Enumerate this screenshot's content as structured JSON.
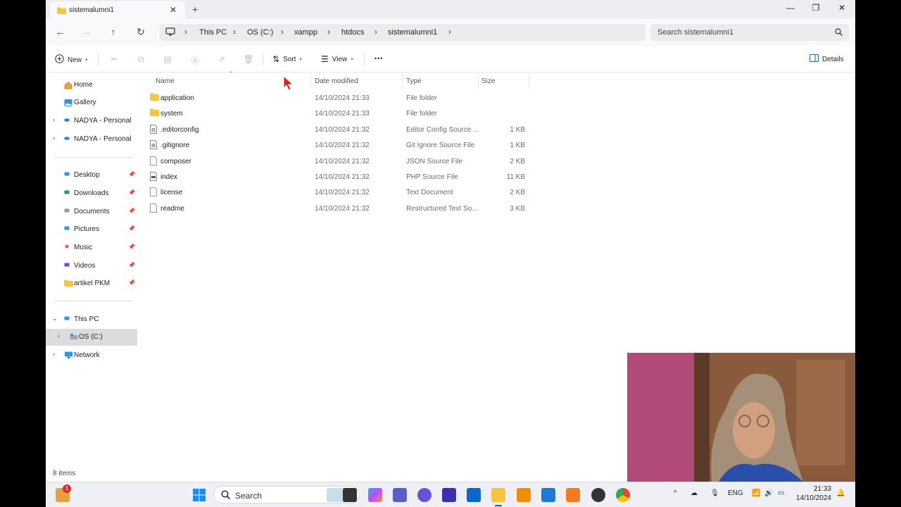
{
  "window": {
    "tab_title": "sistemalumni1",
    "new_tab": "+",
    "close_tab": "✕",
    "minimize": "—",
    "maximize": "❐",
    "close": "✕"
  },
  "address": {
    "crumbs": [
      "This PC",
      "OS (C:)",
      "xampp",
      "htdocs",
      "sistemalumni1"
    ],
    "search_placeholder": "Search sistemalumni1"
  },
  "commands": {
    "new": "New",
    "sort": "Sort",
    "view": "View",
    "more": "•••",
    "details": "Details"
  },
  "sidebar": {
    "quick": [
      {
        "label": "Home",
        "icon": "home-icon"
      },
      {
        "label": "Gallery",
        "icon": "gallery-icon"
      },
      {
        "label": "NADYA - Personal",
        "icon": "onedrive-icon"
      },
      {
        "label": "NADYA - Personal",
        "icon": "onedrive-icon"
      }
    ],
    "pinned": [
      {
        "label": "Desktop",
        "icon": "desktop-icon"
      },
      {
        "label": "Downloads",
        "icon": "downloads-icon"
      },
      {
        "label": "Documents",
        "icon": "documents-icon"
      },
      {
        "label": "Pictures",
        "icon": "pictures-icon"
      },
      {
        "label": "Music",
        "icon": "music-icon"
      },
      {
        "label": "Videos",
        "icon": "videos-icon"
      },
      {
        "label": "artikel PKM",
        "icon": "folder-icon"
      }
    ],
    "tree": [
      {
        "label": "This PC",
        "icon": "pc-icon"
      },
      {
        "label": "OS (C:)",
        "icon": "drive-icon"
      },
      {
        "label": "Network",
        "icon": "network-icon"
      }
    ]
  },
  "columns": {
    "name": "Name",
    "date": "Date modified",
    "type": "Type",
    "size": "Size"
  },
  "files": [
    {
      "name": "application",
      "date": "14/10/2024 21:33",
      "type": "File folder",
      "size": "",
      "icon": "folder-icon"
    },
    {
      "name": "system",
      "date": "14/10/2024 21:33",
      "type": "File folder",
      "size": "",
      "icon": "folder-icon"
    },
    {
      "name": ".editorconfig",
      "date": "14/10/2024 21:32",
      "type": "Editor Config Source ...",
      "size": "1 KB",
      "icon": "config-file-icon"
    },
    {
      "name": ".gitignore",
      "date": "14/10/2024 21:32",
      "type": "Git Ignore Source File",
      "size": "1 KB",
      "icon": "config-file-icon"
    },
    {
      "name": "composer",
      "date": "14/10/2024 21:32",
      "type": "JSON Source File",
      "size": "2 KB",
      "icon": "file-icon"
    },
    {
      "name": "index",
      "date": "14/10/2024 21:32",
      "type": "PHP Source File",
      "size": "11 KB",
      "icon": "php-file-icon"
    },
    {
      "name": "license",
      "date": "14/10/2024 21:32",
      "type": "Text Document",
      "size": "2 KB",
      "icon": "file-icon"
    },
    {
      "name": "readme",
      "date": "14/10/2024 21:32",
      "type": "Restructured Text So...",
      "size": "3 KB",
      "icon": "file-icon"
    }
  ],
  "status": {
    "items_count": "8 items"
  },
  "taskbar": {
    "notification_badge": "1",
    "search_label": "Search",
    "language": "ENG",
    "time": "21:33",
    "date": "14/10/2024"
  },
  "colors": {
    "folder": "#f5c542",
    "accent": "#0067c0",
    "selected": "#dcdcdc"
  }
}
